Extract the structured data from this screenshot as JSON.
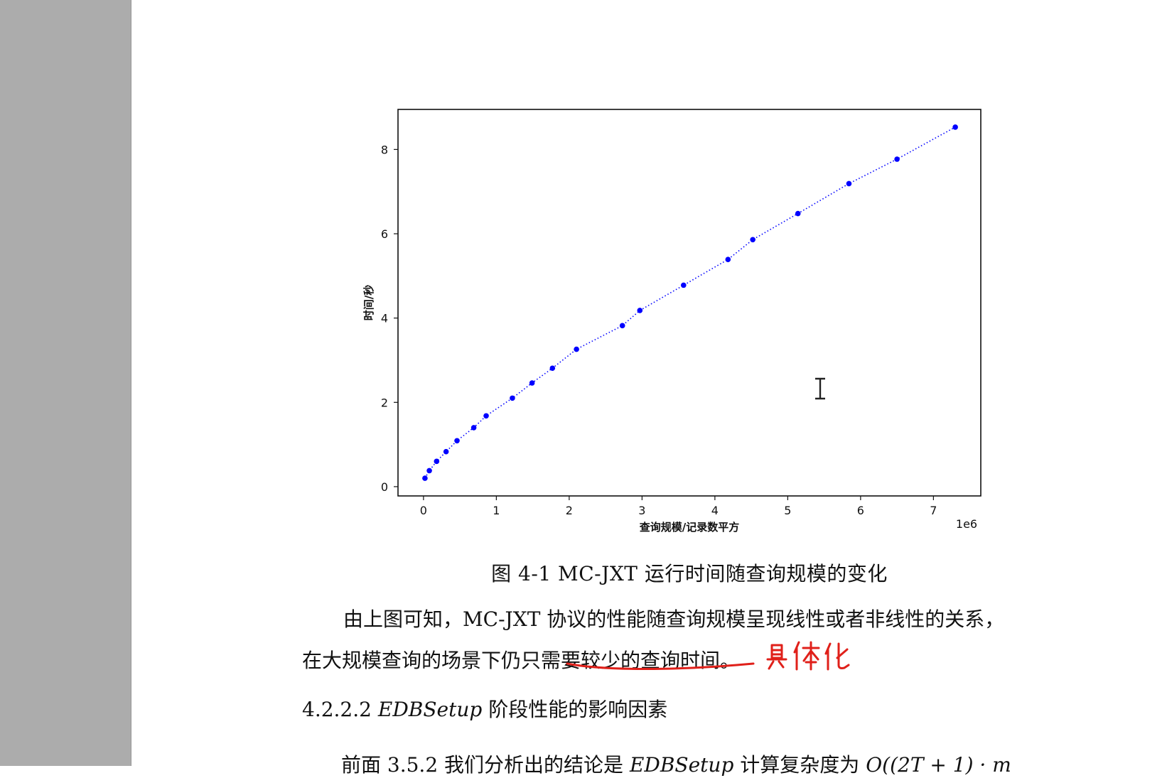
{
  "chart_data": {
    "type": "line",
    "xlabel": "查询规模/记录数平方",
    "ylabel": "时间/秒",
    "x_multiplier_label": "1e6",
    "xlim": [
      -0.35,
      7.65
    ],
    "ylim": [
      -0.22,
      8.95
    ],
    "xticks": [
      0,
      1,
      2,
      3,
      4,
      5,
      6,
      7
    ],
    "yticks": [
      0,
      2,
      4,
      6,
      8
    ],
    "series": [
      {
        "color": "#0000ff",
        "line_style": "dotted",
        "marker": "circle",
        "x": [
          0.02,
          0.08,
          0.18,
          0.31,
          0.46,
          0.69,
          0.86,
          1.22,
          1.49,
          1.77,
          2.1,
          2.73,
          2.97,
          3.57,
          4.18,
          4.52,
          5.14,
          5.84,
          6.5,
          7.3
        ],
        "y": [
          0.2,
          0.38,
          0.6,
          0.83,
          1.09,
          1.4,
          1.68,
          2.1,
          2.46,
          2.81,
          3.26,
          3.82,
          4.18,
          4.78,
          5.39,
          5.86,
          6.48,
          7.19,
          7.77,
          8.53
        ]
      }
    ]
  },
  "caption": "图  4-1  MC-JXT 运行时间随查询规模的变化",
  "paragraph": {
    "line1": "由上图可知，MC-JXT  协议的性能随查询规模呈现线性或者非线性的关系，",
    "line2_plain": "在大规模查询的场景下仍只",
    "line2_underlined": "需要较少的查询时间",
    "line2_end": "。"
  },
  "handwritten_note": "具体化",
  "subheading": {
    "number": "4.2.2.2",
    "math": "EDBSetup",
    "text": " 阶段性能的影响因素"
  },
  "cut_line": {
    "text1": "前面  3.5.2  我们分析出的结论是  ",
    "math1": "EDBSetup",
    "text2": "  计算复杂度为  ",
    "math2": "O((2T + 1) · m"
  },
  "colors": {
    "data": "#0000ff",
    "annotation": "#e0201a",
    "gutter": "#acacac"
  }
}
